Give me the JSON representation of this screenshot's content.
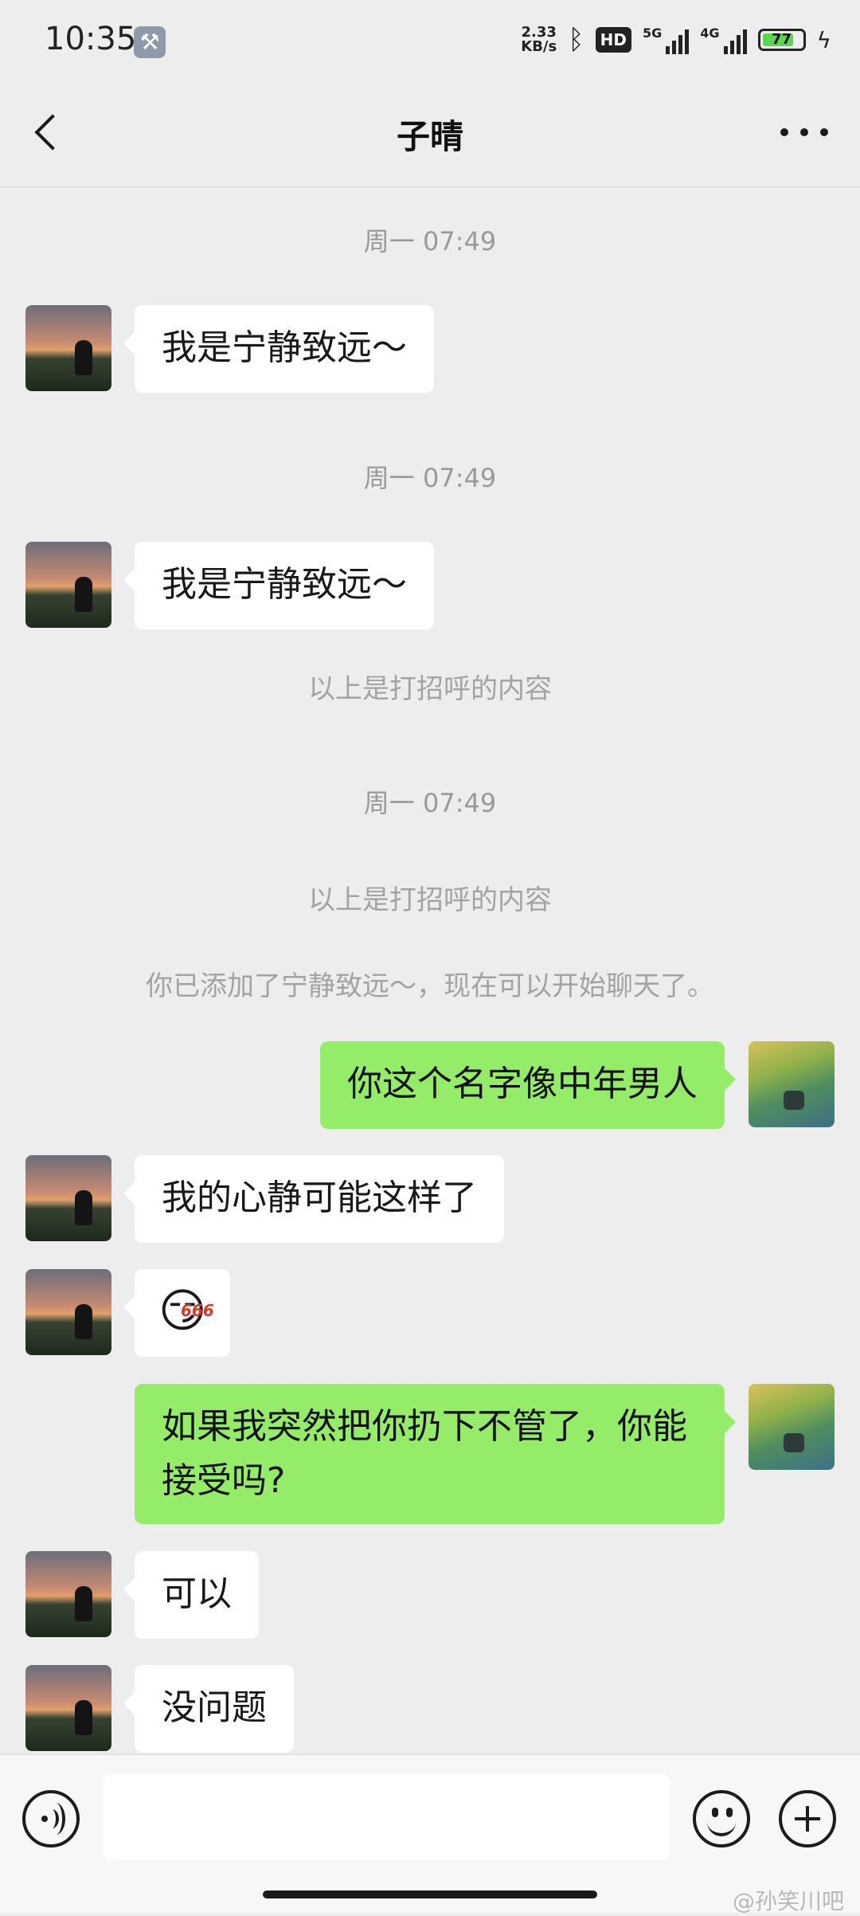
{
  "status_bar": {
    "time": "10:35",
    "net_speed_value": "2.33",
    "net_speed_unit": "KB/s",
    "hd_label": "HD",
    "net1_label": "5G",
    "net2_label": "4G",
    "battery": "77"
  },
  "header": {
    "title": "子晴"
  },
  "messages": {
    "t1": "周一 07:49",
    "m1": "我是宁静致远～",
    "t2": "周一 07:49",
    "m2": "我是宁静致远～",
    "sys1": "以上是打招呼的内容",
    "t3": "周一 07:49",
    "sys2": "以上是打招呼的内容",
    "sys3": "你已添加了宁静致远～，现在可以开始聊天了。",
    "m3": "你这个名字像中年男人",
    "m4": "我的心静可能这样了",
    "m5_emoji": "😏",
    "m5_badge": "666",
    "m6": "如果我突然把你扔下不管了，你能接受吗?",
    "m7": "可以",
    "m8": "没问题"
  },
  "input_bar": {
    "value": "",
    "watermark": "@孙笑川吧"
  },
  "colors": {
    "chat_background": "#ededed",
    "outgoing_bubble": "#95ec69",
    "incoming_bubble": "#ffffff"
  }
}
